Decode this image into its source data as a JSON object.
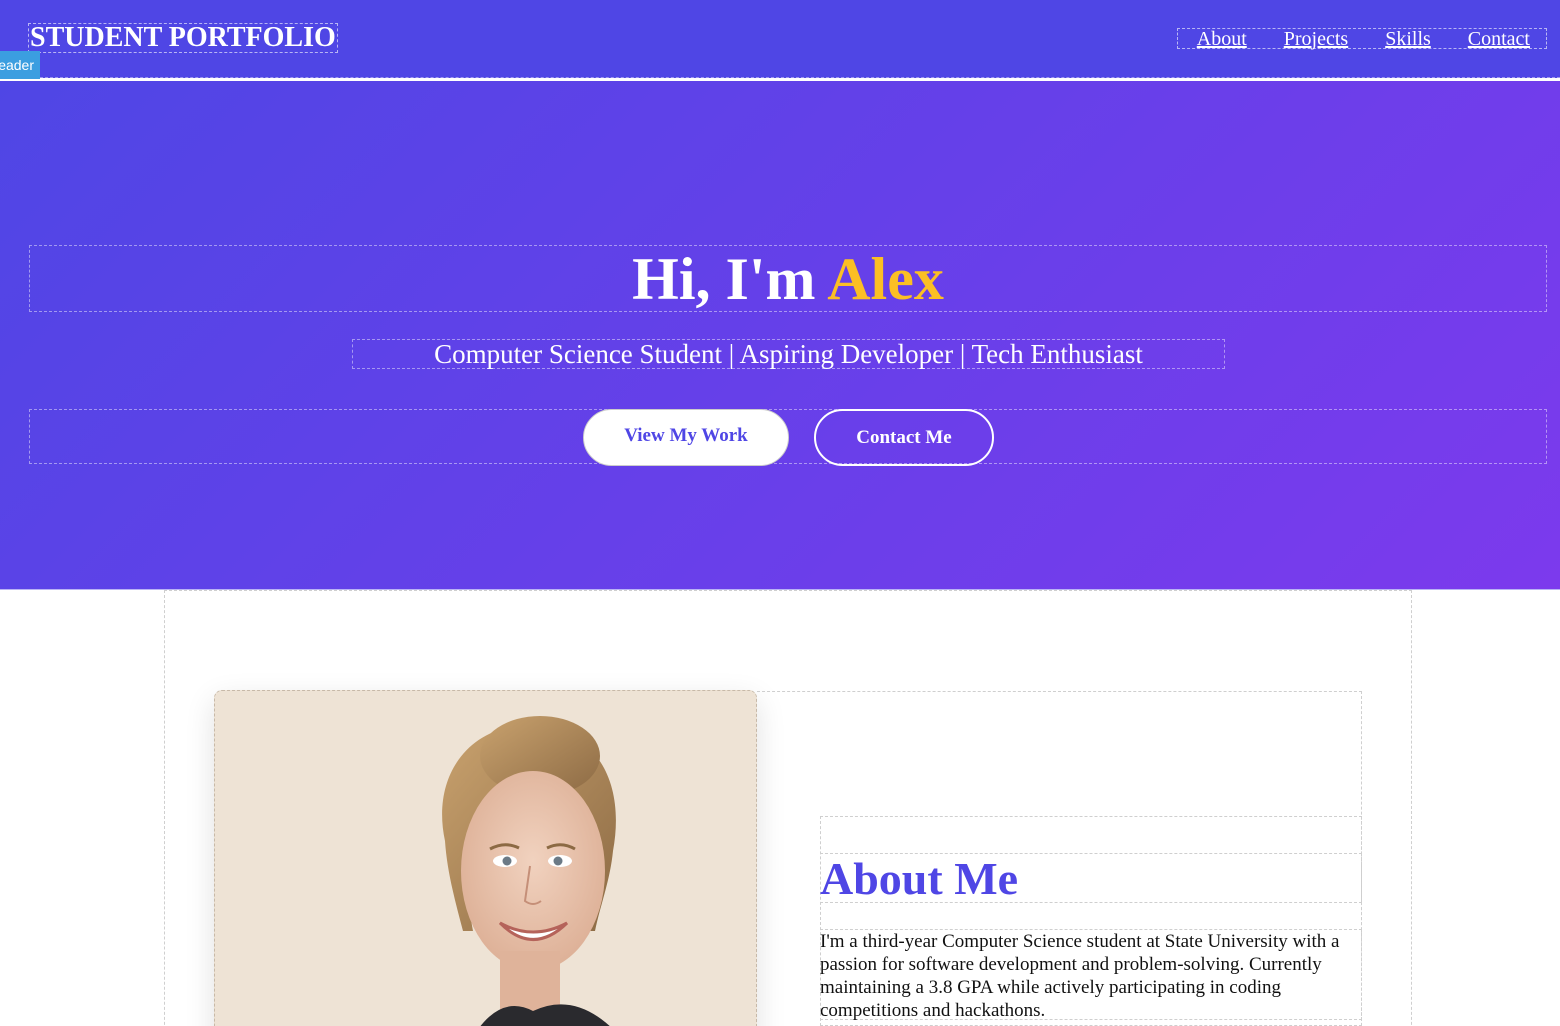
{
  "header": {
    "brand": "STUDENT PORTFOLIO",
    "region_tag": "Header",
    "nav": [
      "About",
      "Projects",
      "Skills",
      "Contact"
    ]
  },
  "hero": {
    "greeting": "Hi, I'm ",
    "name": "Alex",
    "subtitle": "Computer Science Student | Aspiring Developer | Tech Enthusiast",
    "primary_button": "View My Work",
    "secondary_button": "Contact Me"
  },
  "about": {
    "heading": "About Me",
    "paragraph": "I'm a third-year Computer Science student at State University with a passion for software development and problem-solving. Currently maintaining a 3.8 GPA while actively participating in coding competitions and hackathons."
  },
  "colors": {
    "brand": "#4f46e5",
    "gradient_end": "#7c3aed",
    "accent": "#fbbf24",
    "text": "#111111"
  },
  "icons": {
    "portrait": "profile-photo"
  }
}
